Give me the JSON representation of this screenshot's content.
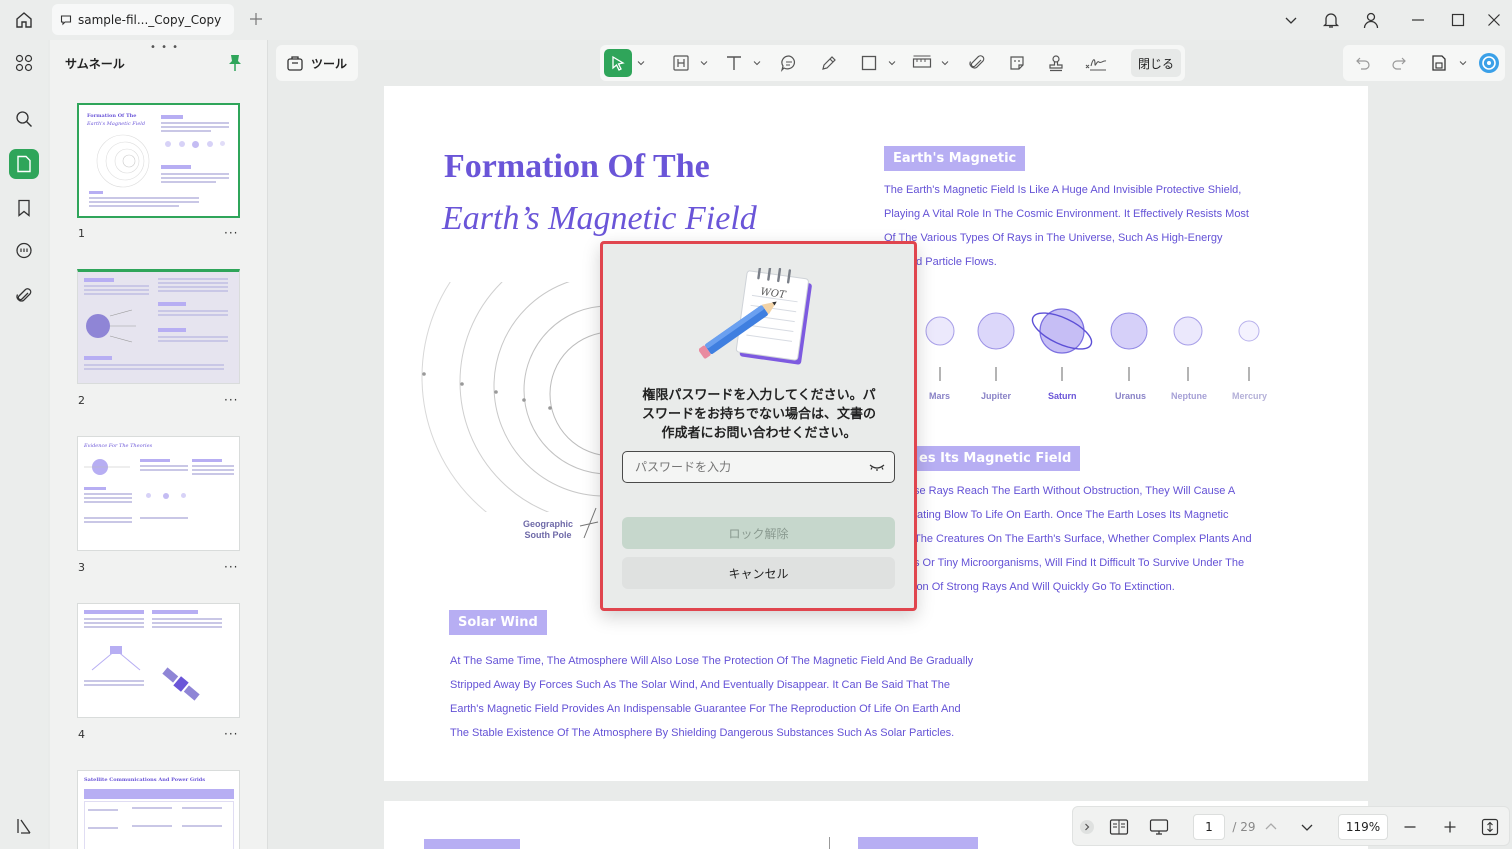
{
  "titlebar": {
    "tab_label": "sample-fil..._Copy_Copy"
  },
  "thumbnails": {
    "title": "サムネール",
    "pages": [
      {
        "num": "1",
        "more": "···",
        "title_line1": "Formation Of The",
        "title_line2": "Earth's Magnetic Field"
      },
      {
        "num": "2",
        "more": "···"
      },
      {
        "num": "3",
        "more": "···",
        "title_line1": "Evidence For The Theories"
      },
      {
        "num": "4",
        "more": "···"
      },
      {
        "title_line1": "Satellite Communications And Power Grids"
      }
    ]
  },
  "toolbar": {
    "tools_label": "ツール",
    "close_label": "閉じる"
  },
  "document": {
    "title_line1": "Formation Of The",
    "title_line2": "Earth’s Magnetic Field",
    "section1_tag": "Earth's Magnetic",
    "section1_lines": [
      "The Earth's Magnetic Field Is Like A Huge And Invisible Protective Shield,",
      "Playing A Vital Role In The Cosmic Environment. It Effectively Resists Most",
      "Of The Various Types Of Rays in The Universe, Such As High-Energy",
      "ed Particle Flows."
    ],
    "planets": [
      "Mars",
      "Jupiter",
      "Saturn",
      "Uranus",
      "Neptune",
      "Mercury"
    ],
    "section2_tag": "es Its Magnetic Field",
    "section2_lines": [
      "se Rays Reach The Earth Without Obstruction, They Will Cause A",
      "tating Blow To Life On Earth. Once The Earth Loses Its Magnetic",
      " The Creatures On The Earth's Surface, Whether Complex Plants And",
      "s Or Tiny Microorganisms, Will Find It Difficult To Survive Under The",
      "ion Of Strong Rays And Will Quickly Go To Extinction."
    ],
    "geo_label_line1": "Geographic",
    "geo_label_line2": "South Pole",
    "section3_tag": "Solar Wind",
    "section3_lines": [
      "At The Same Time, The Atmosphere Will Also Lose The Protection Of The Magnetic Field And Be Gradually",
      "Stripped Away By Forces Such As The Solar Wind, And Eventually Disappear. It Can Be Said That The",
      "Earth's Magnetic Field Provides An Indispensable Guarantee For The Reproduction Of Life On Earth And",
      "The Stable Existence Of The Atmosphere By Shielding Dangerous Substances Such As Solar Particles."
    ]
  },
  "bottombar": {
    "current_page": "1",
    "total_pages": "/ 29",
    "zoom": "119%"
  },
  "dialog": {
    "message_line1": "権限パスワードを入力してください。パ",
    "message_line2": "スワードをお持ちでない場合は、文書の",
    "message_line3": "作成者にお問い合わせください。",
    "password_placeholder": "パスワードを入力",
    "unlock_label": "ロック解除",
    "cancel_label": "キャンセル"
  },
  "colors": {
    "accent_green": "#2fa55a",
    "doc_purple": "#6a55d8",
    "tag_purple": "#b7aef3",
    "dialog_border": "#e0454e"
  }
}
